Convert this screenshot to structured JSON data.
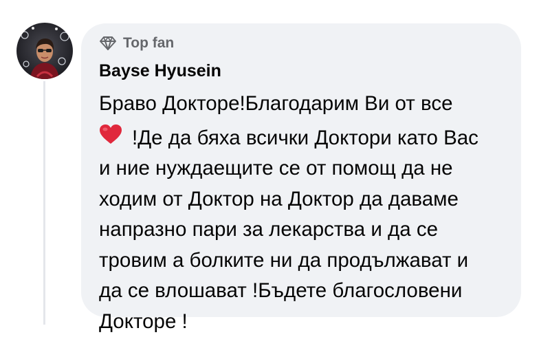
{
  "comment": {
    "badge_icon": "diamond-icon",
    "badge_label": "Top fan",
    "author": "Bayse Hyusein",
    "avatar_icon": "profile-photo",
    "first_line": "Браво Докторе!Благодарим Ви от все",
    "heart_icon": "red-heart-emoji",
    "lines": [
      "!Де да бяха всички Доктори като Вас",
      "и ние нуждаещите се от помощ да не",
      "ходим от Доктор на Доктор да даваме",
      "напразно пари за лекарства и да се",
      "тровим а болките ни да продължават и",
      "да се влошават !Бъдете благословени",
      "Докторе !"
    ],
    "colors": {
      "bubble_bg": "#f0f2f5",
      "meta_text": "#65676b",
      "main_text": "#050505",
      "heart": "#e0283c"
    }
  }
}
